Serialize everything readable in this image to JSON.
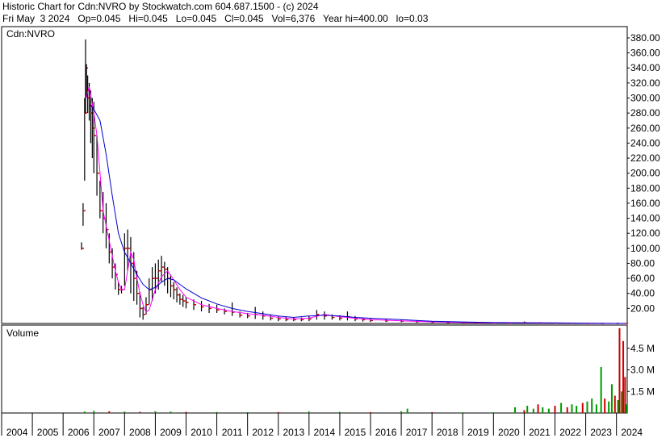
{
  "header": {
    "line1": "Historic Chart for Cdn:NVRO by Stockwatch.com 604.687.1500 - (c) 2024",
    "line2": "Fri May  3 2024   Op=0.045   Hi=0.045   Lo=0.045   Cl=0.045   Vol=6,376   Year hi=400.00   lo=0.03"
  },
  "price_panel": {
    "symbol_label": "Cdn:NVRO"
  },
  "volume_panel": {
    "label": "Volume"
  },
  "colors": {
    "bars": "#000000",
    "close_marks": "#cc0000",
    "ma_short": "#ff00ff",
    "ma_long": "#0000cc",
    "volume_up": "#009900",
    "volume_down": "#cc0000",
    "frame": "#000000"
  },
  "chart_data": [
    {
      "type": "line",
      "title": "Cdn:NVRO",
      "x_axis": {
        "tick_labels": [
          "2004",
          "2005",
          "2006",
          "2007",
          "2008",
          "2009",
          "2010",
          "2011",
          "2012",
          "2013",
          "2014",
          "2015",
          "2016",
          "2017",
          "2018",
          "2019",
          "2020",
          "2021",
          "2022",
          "2023",
          "2024"
        ],
        "range": [
          2004.0,
          2024.35
        ]
      },
      "y_axis": {
        "tick_labels": [
          "20.00",
          "40.00",
          "60.00",
          "80.00",
          "100.00",
          "120.00",
          "140.00",
          "160.00",
          "180.00",
          "200.00",
          "220.00",
          "240.00",
          "260.00",
          "280.00",
          "300.00",
          "320.00",
          "340.00",
          "360.00",
          "380.00"
        ],
        "range": [
          0,
          395
        ],
        "position": "right",
        "grid": false
      },
      "series": [
        {
          "name": "",
          "style": "hlc-bars",
          "x": [
            2006.6,
            2006.65,
            2006.7,
            2006.73,
            2006.76,
            2006.8,
            2006.85,
            2006.9,
            2006.95,
            2007.0,
            2007.1,
            2007.2,
            2007.3,
            2007.4,
            2007.5,
            2007.6,
            2007.7,
            2007.8,
            2007.9,
            2008.0,
            2008.1,
            2008.2,
            2008.3,
            2008.4,
            2008.5,
            2008.6,
            2008.7,
            2008.8,
            2008.9,
            2009.0,
            2009.1,
            2009.2,
            2009.3,
            2009.4,
            2009.5,
            2009.6,
            2009.7,
            2009.8,
            2009.9,
            2010.0,
            2010.25,
            2010.5,
            2010.75,
            2011.0,
            2011.25,
            2011.5,
            2011.75,
            2012.0,
            2012.25,
            2012.5,
            2012.75,
            2013.0,
            2013.25,
            2013.5,
            2013.75,
            2014.0,
            2014.25,
            2014.5,
            2014.75,
            2015.0,
            2015.25,
            2015.5,
            2015.75,
            2016.0,
            2016.5,
            2017.0,
            2017.5,
            2018.0,
            2018.5,
            2019.0,
            2019.5,
            2020.0,
            2020.5,
            2021.0,
            2021.5,
            2022.0,
            2022.5,
            2023.0,
            2023.5,
            2024.0,
            2024.3
          ],
          "high": [
            108,
            160,
            300,
            378,
            345,
            330,
            320,
            310,
            300,
            295,
            250,
            190,
            175,
            160,
            120,
            100,
            80,
            55,
            50,
            120,
            125,
            115,
            95,
            70,
            42,
            22,
            35,
            60,
            75,
            80,
            85,
            90,
            82,
            75,
            65,
            55,
            48,
            40,
            38,
            35,
            32,
            30,
            26,
            25,
            20,
            28,
            16,
            14,
            22,
            16,
            12,
            10,
            9,
            8,
            8,
            10,
            18,
            16,
            12,
            11,
            16,
            10,
            8,
            7,
            6,
            5,
            4,
            3,
            2.5,
            2,
            1.8,
            1.5,
            1.2,
            2.5,
            1.5,
            1.0,
            0.8,
            0.5,
            0.3,
            0.15,
            0.06
          ],
          "low": [
            98,
            130,
            190,
            280,
            300,
            280,
            270,
            240,
            220,
            200,
            170,
            140,
            120,
            100,
            80,
            60,
            45,
            38,
            40,
            50,
            70,
            40,
            30,
            25,
            8,
            5,
            12,
            25,
            30,
            40,
            45,
            55,
            50,
            40,
            35,
            32,
            28,
            25,
            22,
            20,
            18,
            16,
            14,
            14,
            12,
            10,
            8,
            7,
            6,
            5,
            4,
            3,
            3,
            3,
            3,
            3,
            5,
            5,
            5,
            4,
            4,
            3,
            2.5,
            2,
            2,
            1.5,
            1,
            0.8,
            0.6,
            0.5,
            0.4,
            0.3,
            0.2,
            0.3,
            0.2,
            0.15,
            0.1,
            0.05,
            0.04,
            0.03,
            0.03
          ],
          "close": [
            100,
            150,
            280,
            340,
            310,
            300,
            290,
            280,
            260,
            250,
            200,
            150,
            140,
            125,
            95,
            75,
            65,
            45,
            45,
            100,
            100,
            80,
            60,
            40,
            20,
            12,
            25,
            45,
            60,
            60,
            70,
            75,
            72,
            60,
            50,
            45,
            38,
            32,
            30,
            28,
            25,
            22,
            20,
            18,
            16,
            15,
            11,
            10,
            12,
            10,
            7,
            6,
            5,
            5,
            5,
            6,
            12,
            10,
            8,
            7,
            9,
            6,
            5,
            4,
            3.5,
            3,
            2.5,
            1.8,
            1.2,
            1.0,
            0.8,
            0.6,
            0.5,
            1.0,
            0.6,
            0.4,
            0.3,
            0.15,
            0.08,
            0.05,
            0.045
          ]
        },
        {
          "name": "",
          "style": "line",
          "color_key": "ma_short",
          "x": [
            2006.75,
            2006.85,
            2007.0,
            2007.1,
            2007.2,
            2007.3,
            2007.4,
            2007.5,
            2007.6,
            2007.7,
            2007.8,
            2007.9,
            2008.0,
            2008.1,
            2008.2,
            2008.3,
            2008.4,
            2008.5,
            2008.6,
            2008.7,
            2008.8,
            2009.0,
            2009.2,
            2009.4,
            2009.6,
            2009.8,
            2010.0,
            2010.25,
            2010.5,
            2011.0,
            2011.5,
            2012.0,
            2012.5,
            2013.0,
            2013.5,
            2014.0,
            2014.5,
            2015.0,
            2015.5,
            2016.0,
            2017.0,
            2018.0,
            2019.0,
            2020.0,
            2021.0,
            2022.0,
            2023.0,
            2024.3
          ],
          "values": [
            300,
            315,
            280,
            250,
            200,
            150,
            130,
            110,
            90,
            70,
            55,
            45,
            45,
            70,
            95,
            85,
            60,
            40,
            25,
            15,
            18,
            45,
            62,
            70,
            58,
            45,
            35,
            30,
            25,
            20,
            16,
            13,
            11,
            8,
            6,
            7,
            12,
            9,
            7,
            5,
            3.5,
            2.2,
            1.3,
            0.8,
            0.8,
            0.5,
            0.2,
            0.05
          ]
        },
        {
          "name": "",
          "style": "line",
          "color_key": "ma_long",
          "x": [
            2006.9,
            2007.0,
            2007.2,
            2007.4,
            2007.6,
            2007.8,
            2008.0,
            2008.2,
            2008.4,
            2008.6,
            2008.8,
            2009.0,
            2009.2,
            2009.4,
            2009.6,
            2009.8,
            2010.0,
            2010.5,
            2011.0,
            2011.5,
            2012.0,
            2012.5,
            2013.0,
            2013.5,
            2014.0,
            2014.5,
            2015.0,
            2015.5,
            2016.0,
            2017.0,
            2018.0,
            2019.0,
            2020.0,
            2021.0,
            2022.0,
            2023.0,
            2024.3
          ],
          "values": [
            290,
            285,
            270,
            225,
            170,
            120,
            95,
            80,
            65,
            52,
            45,
            48,
            55,
            60,
            58,
            52,
            46,
            34,
            26,
            20,
            16,
            13,
            10,
            8,
            10,
            11,
            10,
            8,
            7,
            5,
            3,
            2,
            1.2,
            1.0,
            0.7,
            0.4,
            0.1
          ]
        }
      ]
    },
    {
      "type": "bar",
      "title": "Volume",
      "x_axis": {
        "range": [
          2004.0,
          2024.35
        ]
      },
      "y_axis": {
        "tick_labels": [
          "1.5 M",
          "3.0 M",
          "4.5 M"
        ],
        "range": [
          0,
          6.0
        ],
        "unit": "M",
        "position": "right"
      },
      "series": [
        {
          "name": "",
          "x": [
            2006.7,
            2007.0,
            2007.5,
            2008.0,
            2008.5,
            2009.0,
            2009.5,
            2010.0,
            2011.0,
            2012.0,
            2013.0,
            2014.0,
            2015.0,
            2016.0,
            2017.0,
            2017.2,
            2018.0,
            2019.0,
            2020.0,
            2020.7,
            2021.0,
            2021.1,
            2021.3,
            2021.45,
            2021.6,
            2021.8,
            2022.0,
            2022.2,
            2022.4,
            2022.55,
            2022.7,
            2022.9,
            2023.05,
            2023.2,
            2023.35,
            2023.5,
            2023.62,
            2023.75,
            2023.85,
            2023.95,
            2024.05,
            2024.1,
            2024.17,
            2024.22,
            2024.28,
            2024.32
          ],
          "values": [
            0.1,
            0.15,
            0.12,
            0.1,
            0.08,
            0.12,
            0.1,
            0.08,
            0.07,
            0.06,
            0.07,
            0.1,
            0.08,
            0.06,
            0.12,
            0.3,
            0.06,
            0.05,
            0.05,
            0.4,
            0.2,
            0.5,
            0.3,
            0.6,
            0.4,
            0.3,
            0.5,
            0.7,
            0.4,
            0.6,
            0.5,
            0.7,
            0.8,
            1.0,
            0.6,
            3.2,
            1.0,
            0.8,
            2.0,
            1.2,
            0.9,
            5.9,
            1.5,
            5.0,
            2.5,
            0.6
          ],
          "colors": [
            "up",
            "up",
            "down",
            "up",
            "down",
            "up",
            "up",
            "down",
            "up",
            "up",
            "down",
            "up",
            "up",
            "down",
            "up",
            "up",
            "down",
            "up",
            "up",
            "up",
            "down",
            "up",
            "up",
            "down",
            "up",
            "up",
            "down",
            "up",
            "down",
            "up",
            "up",
            "down",
            "up",
            "up",
            "up",
            "up",
            "down",
            "up",
            "up",
            "down",
            "up",
            "down",
            "up",
            "down",
            "down",
            "up"
          ]
        }
      ]
    }
  ]
}
